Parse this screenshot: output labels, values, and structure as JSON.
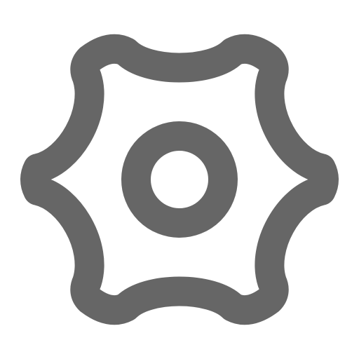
{
  "icon": {
    "name": "gear-icon",
    "stroke_color": "#666666",
    "background_color": "#ffffff"
  }
}
